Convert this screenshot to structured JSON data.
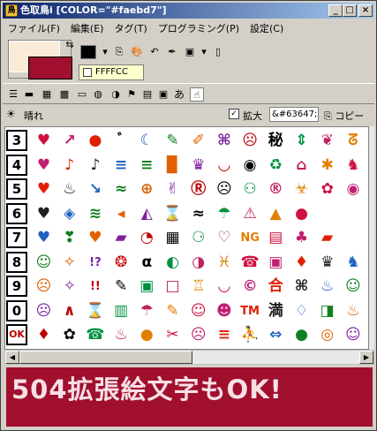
{
  "window": {
    "title": "色取鳥i [COLOR=\"#faebd7\"]",
    "buttons": [
      "_",
      "□",
      "×"
    ]
  },
  "menu": [
    "ファイル(F)",
    "編集(E)",
    "タグ(T)",
    "プログラミング(P)",
    "設定(C)"
  ],
  "colors": {
    "foreground": "#faebd7",
    "background": "#a0102e",
    "current": "#000000",
    "banner_bg": "#a0102e"
  },
  "color_code": "FFFFCC",
  "tool2": {
    "label": "あ"
  },
  "tool3": {
    "sun_label": "晴れ",
    "zoom_label": "拡大",
    "code": "&#63647;",
    "copy_label": "コピー"
  },
  "grid": {
    "row_labels": [
      "3",
      "4",
      "5",
      "6",
      "7",
      "8",
      "9",
      "0",
      "OK"
    ],
    "rows": [
      [
        "♥",
        "↗",
        "●",
        "ﾞ",
        "☾",
        "✎",
        "✐",
        "⌘",
        "☹",
        "秘",
        "⇕",
        "❦",
        "ᘔ"
      ],
      [
        "♥",
        "♪",
        "♪",
        "≡",
        "≡",
        "▉",
        "♛",
        "◡",
        "◉",
        "♻",
        "⌂",
        "✱",
        "♞"
      ],
      [
        "♥",
        "♨",
        "↘",
        "≈",
        "⊕",
        "✌",
        "Ⓡ",
        "☹",
        "⚇",
        "®",
        "☣",
        "✿",
        "◉"
      ],
      [
        "♥",
        "◈",
        "≋",
        "◂",
        "◭",
        "⌛",
        "≈",
        "☂",
        "⚠",
        "▲",
        "●",
        "",
        ""
      ],
      [
        "♥",
        "❣",
        "♥",
        "▰",
        "◔",
        "▦",
        "⚆",
        "♡",
        "NG",
        "▤",
        "♣",
        "▰",
        ""
      ],
      [
        "☺",
        "✧",
        "!?",
        "❂",
        "α",
        "◐",
        "◑",
        "♓",
        "☎",
        "▣",
        "♦",
        "♛",
        "♞"
      ],
      [
        "☹",
        "✧",
        "!!",
        "✎",
        "▣",
        "□",
        "♖",
        "◡",
        "©",
        "合",
        "⌘",
        "♨",
        "☺"
      ],
      [
        "☹",
        "∧",
        "⌛",
        "▥",
        "☂",
        "✎",
        "☺",
        "☻",
        "TM",
        "満",
        "♢",
        "◨",
        "♨"
      ],
      [
        "♦",
        "✿",
        "☎",
        "♨",
        "●",
        "✂",
        "☹",
        "≡",
        "⛹",
        "⇔",
        "●",
        "◎",
        "☺"
      ]
    ]
  },
  "banner": {
    "text": "504拡張絵文字もOK!"
  }
}
